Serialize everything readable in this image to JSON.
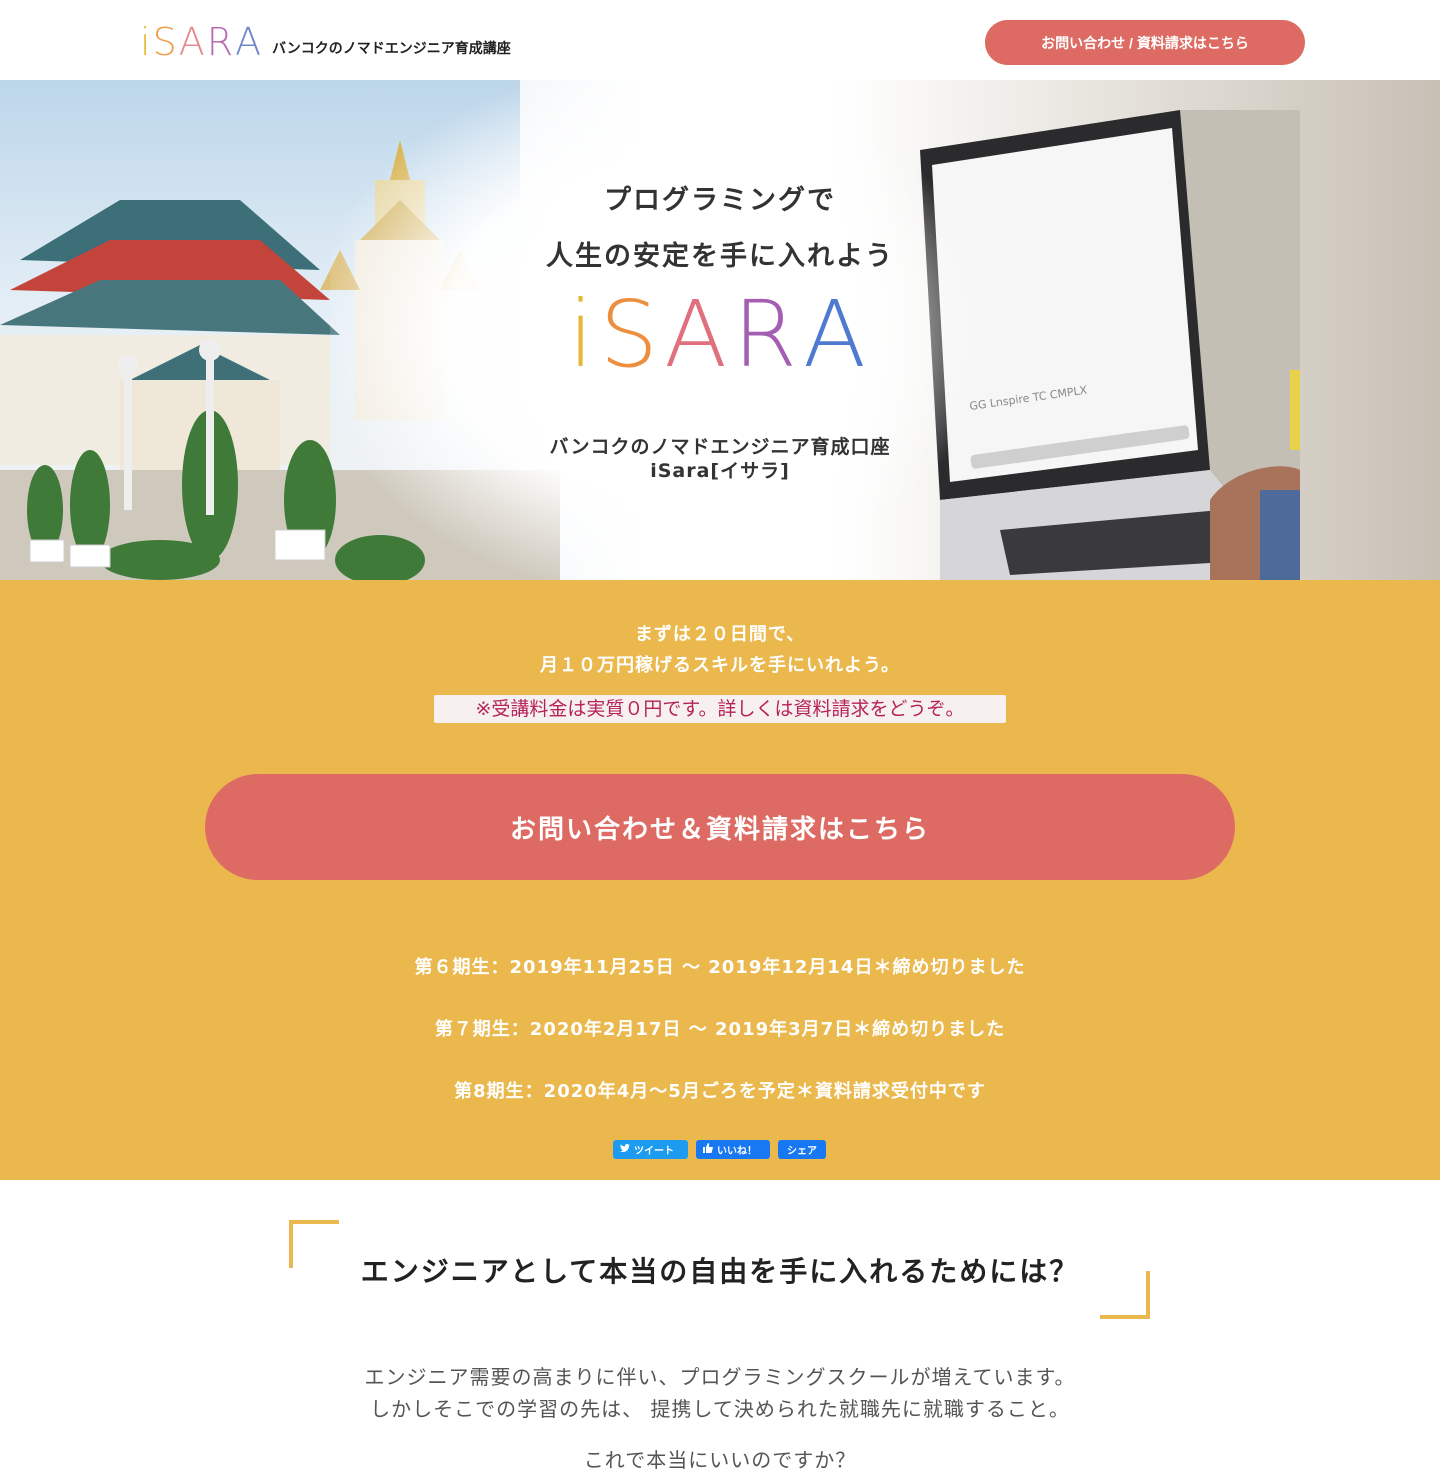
{
  "header": {
    "logo_letters": [
      "i",
      "S",
      "A",
      "R",
      "A"
    ],
    "tagline": "バンコクのノマドエンジニア育成講座",
    "cta_label": "お問い合わせ / 資料請求はこちら"
  },
  "hero": {
    "title_line1": "プログラミングで",
    "title_line2": "人生の安定を手に入れよう",
    "logo_letters": [
      "i",
      "S",
      "A",
      "R",
      "A"
    ],
    "sub_line1": "バンコクのノマドエンジニア育成口座",
    "sub_line2": "iSara[イサラ]",
    "screen_text": "Lnspire  CMPLX"
  },
  "band": {
    "line1": "まずは２０日間で、",
    "line2": "月１０万円稼げるスキルを手にいれよう。",
    "note": "※受講料金は実質０円です。詳しくは資料請求をどうぞ。",
    "cta_label": "お問い合わせ＆資料請求はこちら",
    "terms": [
      "第６期生：2019年11月25日 ～ 2019年12月14日＊締め切りました",
      "第７期生：2020年2月17日 ～ 2019年3月7日＊締め切りました",
      "第8期生：2020年4月～5月ごろを予定＊資料請求受付中です"
    ],
    "share": {
      "tweet": "ツイート",
      "like": "いいね！",
      "share": "シェア"
    }
  },
  "section": {
    "title": "エンジニアとして本当の自由を手に入れるためには？",
    "para_line1": "エンジニア需要の高まりに伴い、プログラミングスクールが増えています。",
    "para_line2": "しかしそこでの学習の先は、 提携して決められた就職先に就職すること。",
    "question": "これで本当にいいのですか？"
  },
  "colors": {
    "accent_coral": "#dd6b64",
    "band_yellow": "#ebb84d",
    "note_text": "#b7225b",
    "logo_gradient": [
      "#e8b93a",
      "#e98a6c",
      "#c04a8b",
      "#5a6fd1",
      "#3aa6c9"
    ]
  }
}
